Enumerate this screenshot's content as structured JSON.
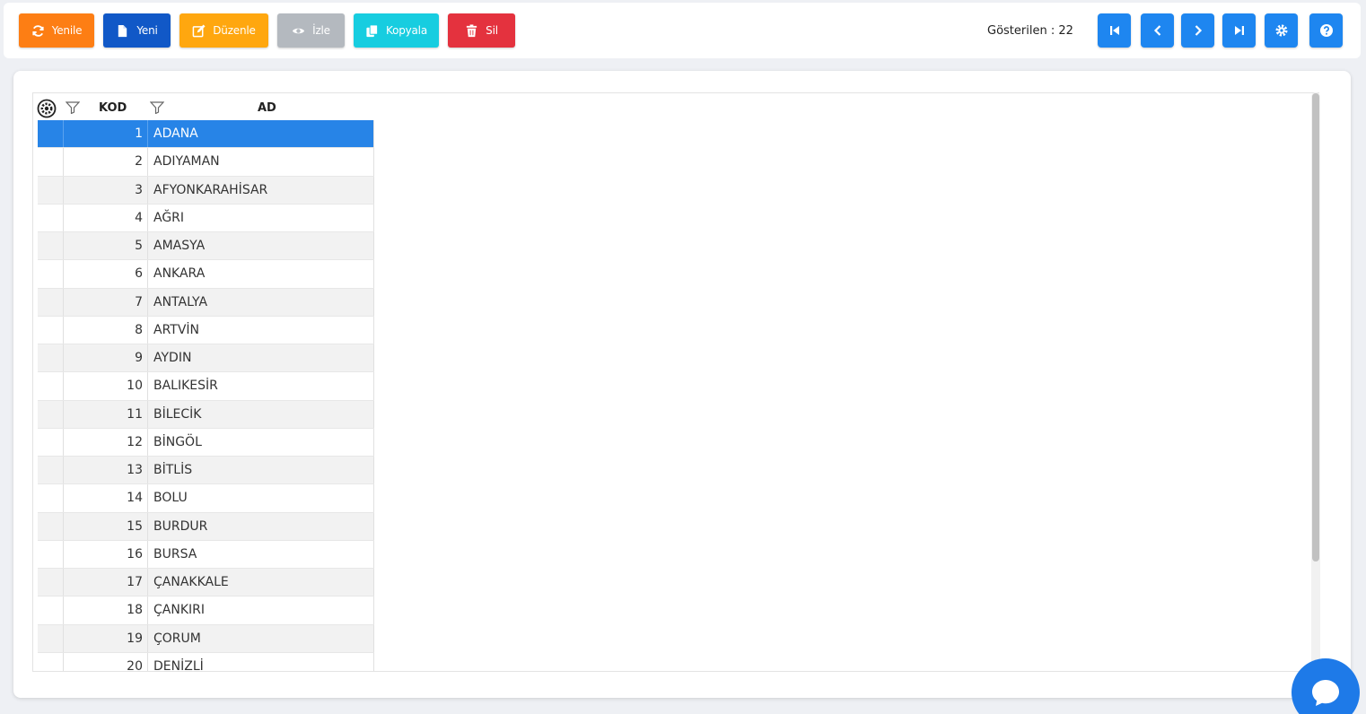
{
  "toolbar": {
    "buttons": {
      "refresh": "Yenile",
      "new": "Yeni",
      "edit": "Düzenle",
      "view": "İzle",
      "copy": "Kopyala",
      "delete": "Sil"
    },
    "count_label": "Gösterilen : 22",
    "nav_icons": [
      "first-page-icon",
      "previous-page-icon",
      "next-page-icon",
      "last-page-icon",
      "gear-icon",
      "help-icon"
    ]
  },
  "grid": {
    "columns": [
      "KOD",
      "AD"
    ],
    "selected_index": 0,
    "rows": [
      {
        "kod": "1",
        "ad": "ADANA"
      },
      {
        "kod": "2",
        "ad": "ADIYAMAN"
      },
      {
        "kod": "3",
        "ad": "AFYONKARAHİSAR"
      },
      {
        "kod": "4",
        "ad": "AĞRI"
      },
      {
        "kod": "5",
        "ad": "AMASYA"
      },
      {
        "kod": "6",
        "ad": "ANKARA"
      },
      {
        "kod": "7",
        "ad": "ANTALYA"
      },
      {
        "kod": "8",
        "ad": "ARTVİN"
      },
      {
        "kod": "9",
        "ad": "AYDIN"
      },
      {
        "kod": "10",
        "ad": "BALIKESİR"
      },
      {
        "kod": "11",
        "ad": "BİLECİK"
      },
      {
        "kod": "12",
        "ad": "BİNGÖL"
      },
      {
        "kod": "13",
        "ad": "BİTLİS"
      },
      {
        "kod": "14",
        "ad": "BOLU"
      },
      {
        "kod": "15",
        "ad": "BURDUR"
      },
      {
        "kod": "16",
        "ad": "BURSA"
      },
      {
        "kod": "17",
        "ad": "ÇANAKKALE"
      },
      {
        "kod": "18",
        "ad": "ÇANKIRI"
      },
      {
        "kod": "19",
        "ad": "ÇORUM"
      },
      {
        "kod": "20",
        "ad": "DENİZLİ"
      }
    ]
  },
  "colors": {
    "refresh": "#fd7e14",
    "new": "#1158c7",
    "edit": "#ffa70f",
    "view": "#b4b9bf",
    "copy": "#17cde0",
    "delete": "#e4323e",
    "nav": "#1e86f0",
    "selected_row": "#2784e7"
  }
}
